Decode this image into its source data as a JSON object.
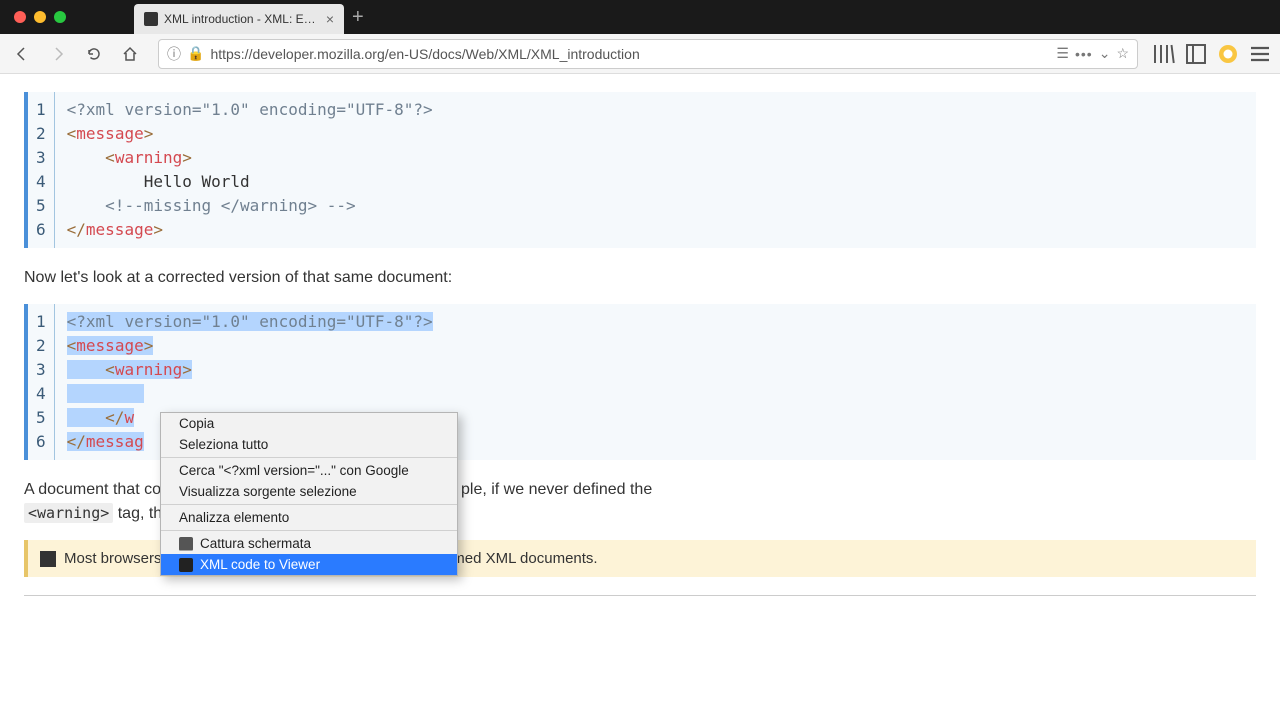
{
  "tab": {
    "title": "XML introduction - XML: Extens"
  },
  "url": "https://developer.mozilla.org/en-US/docs/Web/XML/XML_introduction",
  "code_block_1": {
    "lines": [
      "1",
      "2",
      "3",
      "4",
      "5",
      "6"
    ],
    "l1_prolog": "<?xml version=\"1.0\" encoding=\"UTF-8\"?>",
    "l2_open": "<",
    "l2_name": "message",
    "l2_close": ">",
    "l3_pad": "    ",
    "l3_open": "<",
    "l3_name": "warning",
    "l3_close": ">",
    "l4_pad": "        ",
    "l4_text": "Hello World",
    "l5_pad": "    ",
    "l5_comment": "<!--missing </warning> -->",
    "l6_open": "</",
    "l6_name": "message",
    "l6_close": ">"
  },
  "paragraph_1": "Now let's look at a corrected version of that same document:",
  "code_block_2": {
    "lines": [
      "1",
      "2",
      "3",
      "4",
      "5",
      "6"
    ],
    "l1_prolog": "<?xml version=\"1.0\" encoding=\"UTF-8\"?>",
    "l2_open": "<",
    "l2_name": "message",
    "l2_close": ">",
    "l3_pad": "    ",
    "l3_open": "<",
    "l3_name": "warning",
    "l3_close": ">",
    "l4_pad": "        ",
    "l5_pad": "    ",
    "l5_open": "</",
    "l5_name": "w",
    "l6_open": "</",
    "l6_name": "messag"
  },
  "paragraph_2_pre": "A document that co",
  "paragraph_2_post": "ple, if we never defined the ",
  "inline_code": "<warning>",
  "paragraph_2_tail": " tag, th",
  "note_text": "Most browsers offer a debugger that can identify poorly-formed XML documents.",
  "context_menu": {
    "copy": "Copia",
    "select_all": "Seleziona tutto",
    "search_google": "Cerca \"<?xml version=\"...\" con Google",
    "view_source": "Visualizza sorgente selezione",
    "inspect": "Analizza elemento",
    "screenshot": "Cattura schermata",
    "xml_viewer": "XML code to Viewer"
  }
}
